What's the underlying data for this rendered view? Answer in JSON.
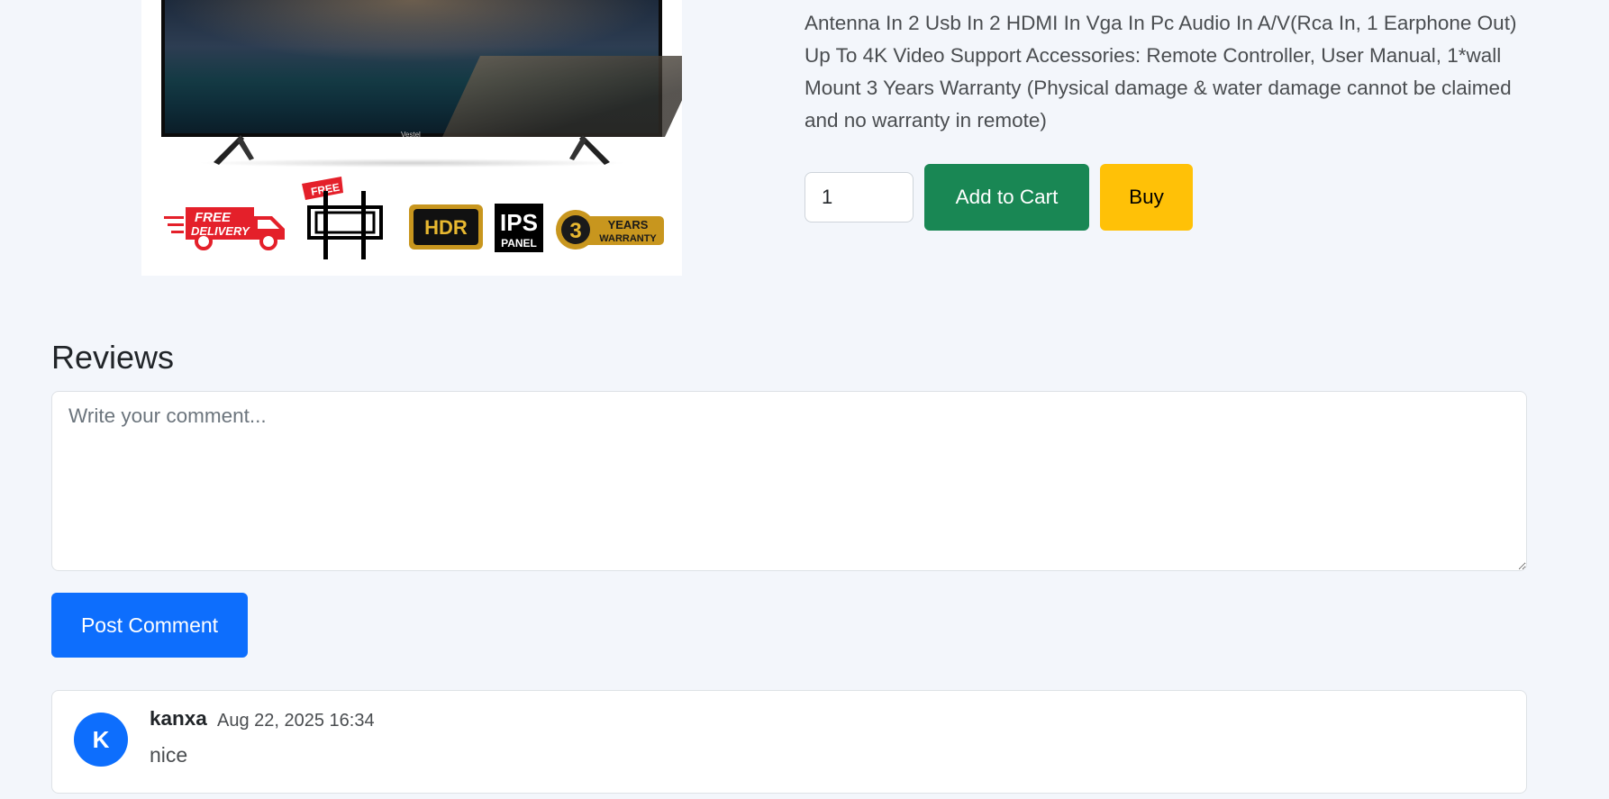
{
  "product": {
    "tv_brand": "Vestel",
    "badges": {
      "delivery_line1": "FREE",
      "delivery_line2": "DELIVERY",
      "mount_tag": "FREE",
      "hdr": "HDR",
      "ips_line1": "IPS",
      "ips_line2": "PANEL",
      "warranty_number": "3",
      "warranty_line1": "YEARS",
      "warranty_line2": "WARRANTY"
    },
    "description": "Antenna In 2 Usb In 2 HDMI In Vga In Pc Audio In A/V(Rca In, 1 Earphone Out) Up To 4K Video Support Accessories: Remote Controller, User Manual, 1*wall Mount 3 Years Warranty (Physical damage & water damage cannot be claimed and no warranty in remote)",
    "quantity": "1",
    "add_to_cart_label": "Add to Cart",
    "buy_label": "Buy"
  },
  "reviews": {
    "title": "Reviews",
    "comment_placeholder": "Write your comment...",
    "post_label": "Post Comment",
    "items": [
      {
        "avatar_initial": "K",
        "author": "kanxa",
        "date": "Aug 22, 2025 16:34",
        "text": "nice"
      }
    ]
  },
  "colors": {
    "background": "#f3f6fb",
    "cart_button": "#198754",
    "buy_button": "#ffc107",
    "primary": "#0d6efd"
  }
}
